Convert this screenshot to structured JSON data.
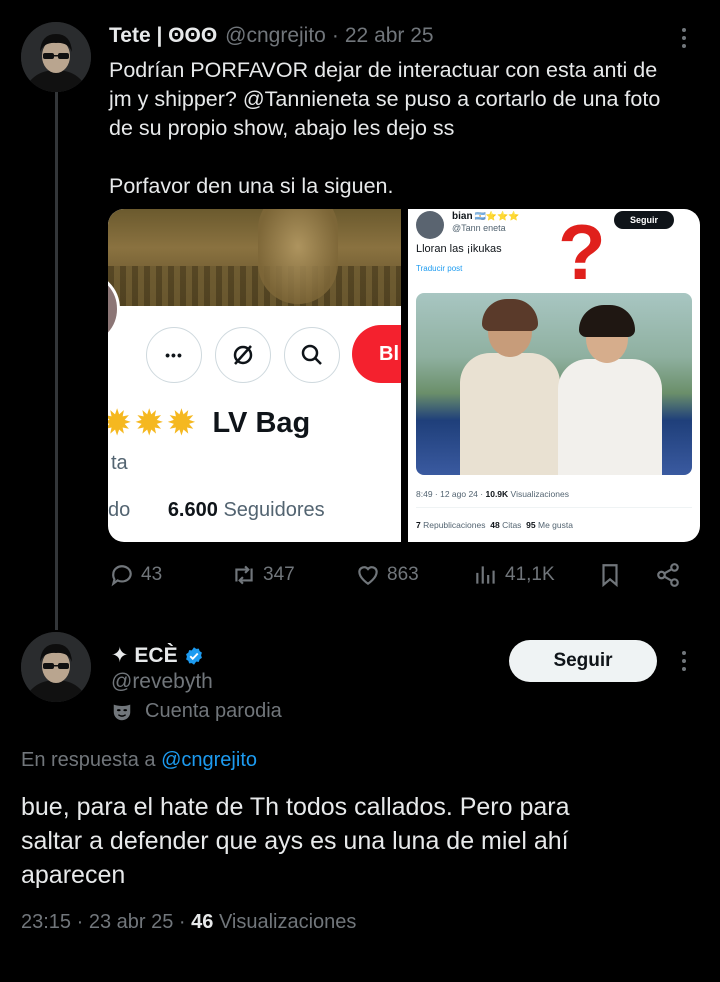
{
  "colors": {
    "background": "#000000",
    "text_primary": "#e7e9ea",
    "text_secondary": "#71767b",
    "link": "#1d9bf0",
    "verified": "#1d9bf0",
    "follow_button_bg": "#eff3f4",
    "block_button_red": "#f4212e"
  },
  "tweet1": {
    "display_name": "Tete | ʘʘʘ",
    "handle": "@cngrejito",
    "separator": "·",
    "date": "22 abr 25",
    "text_lines": [
      "Podrían PORFAVOR dejar de interactuar con esta anti de",
      "jm y shipper? @Tannieneta se puso a cortarlo de una foto",
      "de su propio show, abajo les dejo ss"
    ],
    "text_line_last": "Porfavor den una si la siguen.",
    "media_left": {
      "more_glyph": "•••",
      "block_label": "Bl",
      "stars": "✹✹✹",
      "name": "LV Bag",
      "sub": "ta",
      "stat_left": "do",
      "followers_count": "6.600",
      "followers_label": "Seguidores"
    },
    "media_right": {
      "name": "bian",
      "name_stars": "🇦🇷⭐⭐⭐",
      "handle": "@Tann eneta",
      "follow_label": "Seguir",
      "text": "Lloran las ¡ikukas",
      "translate": "Traducir post",
      "question_mark": "?",
      "meta_time": "8:49 · 12 ago 24 ·",
      "meta_views": "10.9K",
      "meta_views_label": "Visualizaciones",
      "reposts": "7",
      "reposts_label": "Republicaciones",
      "quotes": "48",
      "quotes_label": "Citas",
      "likes": "95",
      "likes_label": "Me gusta"
    },
    "actions": {
      "replies": "43",
      "reposts": "347",
      "likes": "863",
      "views": "41,1K"
    }
  },
  "tweet2": {
    "display_name": "✦ ECÈ",
    "handle": "@revebyth",
    "parody_label": "Cuenta parodia",
    "follow_label": "Seguir",
    "reply_prefix": "En respuesta a",
    "reply_handle": "@cngrejito",
    "text_lines": [
      "bue, para el hate de Th todos callados. Pero para",
      "saltar a defender que ays es una luna de miel ahí",
      "aparecen"
    ],
    "time": "23:15 · 23 abr 25 ·",
    "views_count": "46",
    "views_label": "Visualizaciones"
  }
}
